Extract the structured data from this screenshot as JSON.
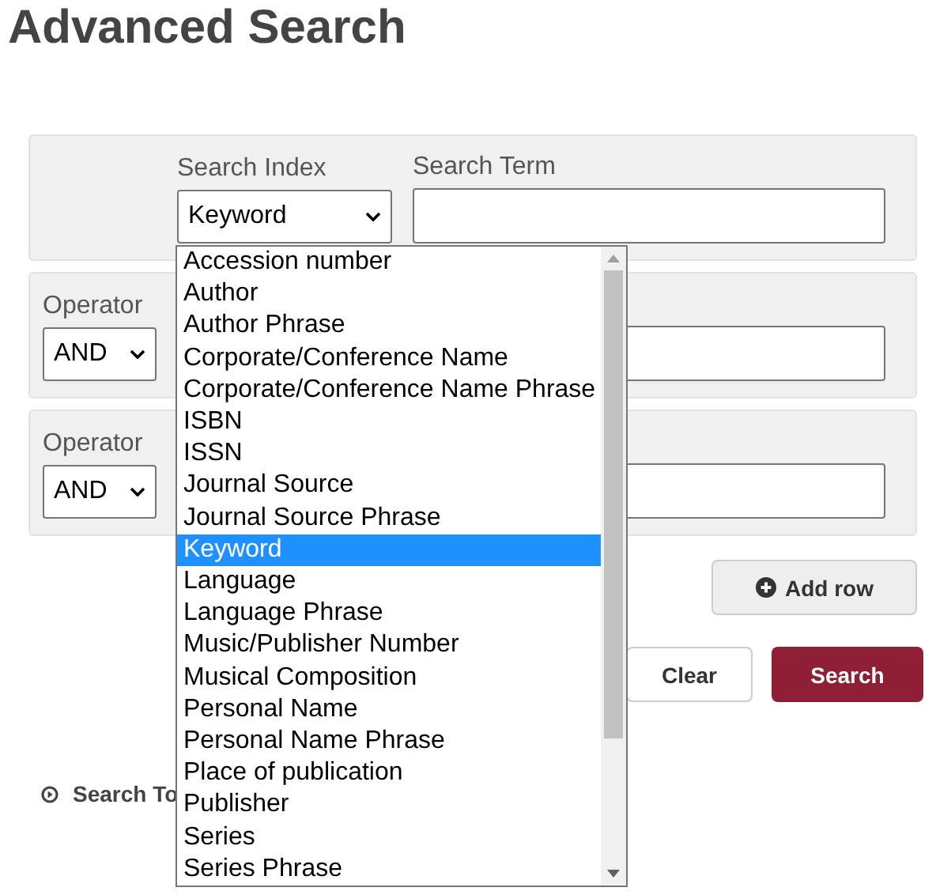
{
  "title": "Advanced Search",
  "first_row": {
    "index_label": "Search Index",
    "index_value": "Keyword",
    "term_label": "Search Term"
  },
  "operator_rows": [
    {
      "label": "Operator",
      "value": "AND"
    },
    {
      "label": "Operator",
      "value": "AND"
    }
  ],
  "add_row_button": "Add row",
  "clear_button": "Clear",
  "search_button": "Search",
  "search_tips": "Search To",
  "dropdown": {
    "options": [
      {
        "label": "Accession number",
        "selected": false
      },
      {
        "label": "Author",
        "selected": false
      },
      {
        "label": "Author Phrase",
        "selected": false
      },
      {
        "label": "Corporate/Conference Name",
        "selected": false
      },
      {
        "label": "Corporate/Conference Name Phrase",
        "selected": false
      },
      {
        "label": "ISBN",
        "selected": false
      },
      {
        "label": "ISSN",
        "selected": false
      },
      {
        "label": "Journal Source",
        "selected": false
      },
      {
        "label": "Journal Source Phrase",
        "selected": false
      },
      {
        "label": "Keyword",
        "selected": true
      },
      {
        "label": "Language",
        "selected": false
      },
      {
        "label": "Language Phrase",
        "selected": false
      },
      {
        "label": "Music/Publisher Number",
        "selected": false
      },
      {
        "label": "Musical Composition",
        "selected": false
      },
      {
        "label": "Personal Name",
        "selected": false
      },
      {
        "label": "Personal Name Phrase",
        "selected": false
      },
      {
        "label": "Place of publication",
        "selected": false
      },
      {
        "label": "Publisher",
        "selected": false
      },
      {
        "label": "Series",
        "selected": false
      },
      {
        "label": "Series Phrase",
        "selected": false
      }
    ]
  }
}
